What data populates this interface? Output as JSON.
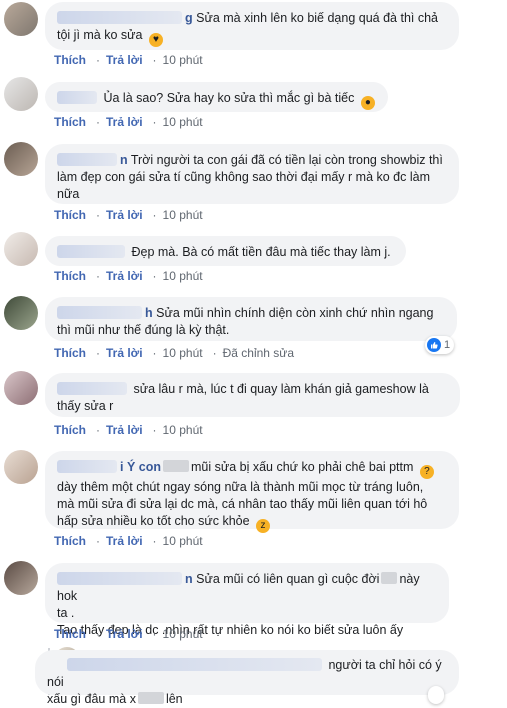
{
  "comments": [
    {
      "name_tail": "g",
      "lines": [
        "Sửa mà xinh lên ko biế dạng quá đà thì chả",
        "tội jì mà ko sửa"
      ],
      "emoji": "smiling-face-with-hearts",
      "like": "Thích",
      "reply": "Trả lời",
      "time": "10 phút"
    },
    {
      "name_tail": "",
      "lines": [
        "Ủa là sao? Sửa hay ko sửa thì mắc gì bà tiếc"
      ],
      "emoji": "worried-face",
      "like": "Thích",
      "reply": "Trả lời",
      "time": "10 phút"
    },
    {
      "name_tail": "n",
      "lines": [
        "Trời người ta con gái đã có tiền lại còn trong showbiz thì",
        "làm đẹp con gái sửa tí cũng không sao thời đại mấy r mà ko đc làm",
        "nữa"
      ],
      "like": "Thích",
      "reply": "Trả lời",
      "time": "10 phút"
    },
    {
      "name_tail": "",
      "lines": [
        "Đẹp mà. Bà có mất tiền đâu mà tiếc thay làm j."
      ],
      "like": "Thích",
      "reply": "Trả lời",
      "time": "10 phút"
    },
    {
      "name_tail": "h",
      "lines": [
        "Sửa mũi nhìn chính diện còn xinh chứ nhìn ngang",
        "thì mũi như thế đúng là kỳ thật."
      ],
      "like": "Thích",
      "reply": "Trả lời",
      "time": "10 phút",
      "edited": "Đã chỉnh sửa",
      "reaction_count": "1"
    },
    {
      "name_tail": "",
      "lines": [
        "sửa lâu r mà, lúc t đi quay làm khán giả gameshow là",
        "thấy sửa r"
      ],
      "like": "Thích",
      "reply": "Trả lời",
      "time": "10 phút"
    },
    {
      "name_tail": "i Ý con",
      "line1_after_mask": "mũi sửa bị xấu chứ ko phải chê bai pttm",
      "lines": [
        "dày thêm một chút ngay sóng nữa là thành mũi mọc từ tráng luôn,",
        "mà mũi sửa đi sửa lại dc mà, cá nhân tao thấy mũi liên quan tới hô",
        "hấp sửa nhiều ko tốt cho sức khỏe"
      ],
      "emoji": "thinking-face",
      "emoji2": "sleepy-face",
      "like": "Thích",
      "reply": "Trả lời",
      "time": "10 phút"
    },
    {
      "name_tail": "n",
      "line1_before_mask": "Sửa mũi có liên quan gì cuộc đời",
      "line1_after_mask": "này hok",
      "lines": [
        "ta .",
        "Tao thấy đẹp là dc .nhìn rất tự nhiên ko nói ko biết sửa luôn ấy"
      ],
      "like": "Thích",
      "reply": "Trả lời",
      "time": "10 phút"
    },
    {
      "line1": "người ta chỉ hỏi có ý nói",
      "line2_before_mask": "xấu gì đâu mà x",
      "line2_after_mask": "lên"
    }
  ]
}
